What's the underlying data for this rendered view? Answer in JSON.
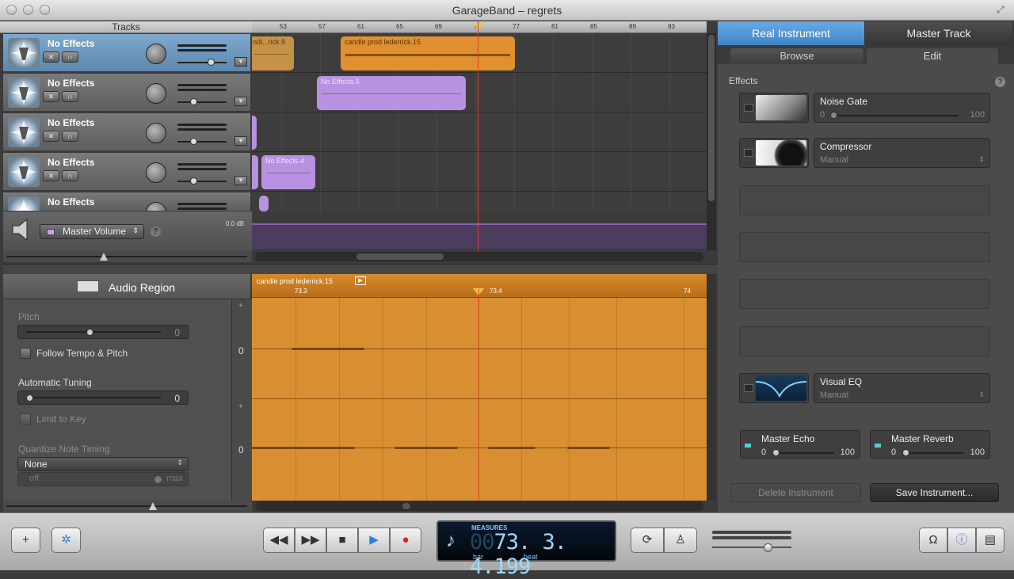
{
  "window": {
    "title": "GarageBand – regrets"
  },
  "tracks_header": "Tracks",
  "ruler": {
    "measures": [
      "53",
      "57",
      "61",
      "65",
      "69",
      "73",
      "77",
      "81",
      "85",
      "89",
      "93"
    ]
  },
  "tracks": [
    {
      "name": "No Effects",
      "selected": true,
      "volume": 0.7
    },
    {
      "name": "No Effects",
      "selected": false,
      "volume": 0.3
    },
    {
      "name": "No Effects",
      "selected": false,
      "volume": 0.3
    },
    {
      "name": "No Effects",
      "selected": false,
      "volume": 0.3
    },
    {
      "name": "No Effects",
      "selected": false,
      "volume": 0.3
    }
  ],
  "regions": [
    {
      "name": "ndl...rick.9",
      "color": "#e0a54f"
    },
    {
      "name": "candle prod lederrick.15",
      "color": "#e0902e"
    },
    {
      "name": "No Effects.5",
      "color": "#b892e0"
    },
    {
      "name": "No Effects.4",
      "color": "#b892e0"
    }
  ],
  "master": {
    "selector": "Master Volume",
    "level": "0.0 dB"
  },
  "editor": {
    "title": "Audio Region",
    "pitch_label": "Pitch",
    "pitch_value": "0",
    "follow_tempo": "Follow Tempo & Pitch",
    "auto_tuning_label": "Automatic Tuning",
    "auto_tuning_value": "0",
    "limit_to_key": "Limit to Key",
    "quantize_label": "Quantize Note Timing",
    "quantize_value": "None",
    "quantize_off": "off",
    "quantize_max": "max",
    "region_name": "candle prod lederrick.15",
    "ruler_marks": [
      "73.3",
      "73.4",
      "74"
    ],
    "row_zero": "0"
  },
  "right_panel": {
    "tab_real": "Real Instrument",
    "tab_master": "Master Track",
    "sub_browse": "Browse",
    "sub_edit": "Edit",
    "effects_label": "Effects",
    "effects": [
      {
        "name": "Noise Gate",
        "min": "0",
        "max": "100"
      },
      {
        "name": "Compressor",
        "preset": "Manual"
      },
      {
        "name": "Visual EQ",
        "preset": "Manual"
      }
    ],
    "sends": [
      {
        "name": "Master Echo",
        "min": "0",
        "max": "100"
      },
      {
        "name": "Master Reverb",
        "min": "0",
        "max": "100"
      }
    ],
    "delete_btn": "Delete Instrument",
    "save_btn": "Save Instrument..."
  },
  "lcd": {
    "mode": "MEASURES",
    "value": "73. 3. 4.199",
    "ghost": "00",
    "bar_label": "bar",
    "beat_label": "beat"
  },
  "colors": {
    "accent": "#3e84c4",
    "playhead": "#e23b2b",
    "region_orange": "#d88f31",
    "region_purple": "#b892e0"
  }
}
